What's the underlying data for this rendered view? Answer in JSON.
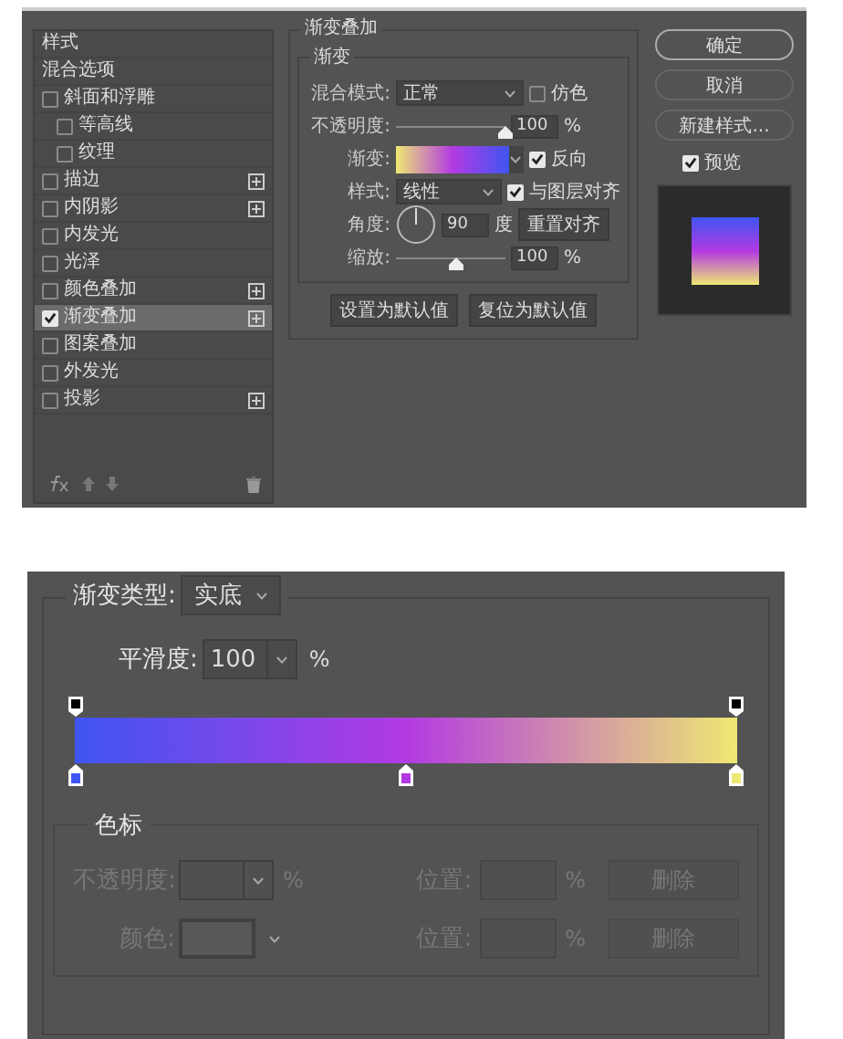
{
  "layer_style": {
    "styles_list": [
      {
        "label": "样式",
        "kind": "header",
        "selected": false
      },
      {
        "label": "混合选项",
        "kind": "header",
        "selected": false
      },
      {
        "label": "斜面和浮雕",
        "kind": "checkbox",
        "checked": false,
        "selected": false,
        "children": [
          {
            "label": "等高线",
            "kind": "checkbox",
            "checked": false,
            "selected": false
          },
          {
            "label": "纹理",
            "kind": "checkbox",
            "checked": false,
            "selected": false
          }
        ]
      },
      {
        "label": "描边",
        "kind": "checkbox",
        "checked": false,
        "selected": false,
        "add_button": true
      },
      {
        "label": "内阴影",
        "kind": "checkbox",
        "checked": false,
        "selected": false,
        "add_button": true
      },
      {
        "label": "内发光",
        "kind": "checkbox",
        "checked": false,
        "selected": false
      },
      {
        "label": "光泽",
        "kind": "checkbox",
        "checked": false,
        "selected": false
      },
      {
        "label": "颜色叠加",
        "kind": "checkbox",
        "checked": false,
        "selected": false,
        "add_button": true
      },
      {
        "label": "渐变叠加",
        "kind": "checkbox",
        "checked": true,
        "selected": true,
        "add_button": true
      },
      {
        "label": "图案叠加",
        "kind": "checkbox",
        "checked": false,
        "selected": false
      },
      {
        "label": "外发光",
        "kind": "checkbox",
        "checked": false,
        "selected": false
      },
      {
        "label": "投影",
        "kind": "checkbox",
        "checked": false,
        "selected": false,
        "add_button": true
      }
    ],
    "section_title": "渐变叠加",
    "group_title": "渐变",
    "blend_mode": {
      "label": "混合模式:",
      "value": "正常"
    },
    "dither": {
      "label": "仿色",
      "checked": false
    },
    "opacity": {
      "label": "不透明度:",
      "level": 1,
      "value": "100",
      "unit": "%"
    },
    "gradient": {
      "label": "渐变:"
    },
    "reverse": {
      "label": "反向",
      "checked": true
    },
    "style": {
      "label": "样式:",
      "value": "线性"
    },
    "align": {
      "label": "与图层对齐",
      "checked": true
    },
    "angle": {
      "label": "角度:",
      "value": "90",
      "unit": "度"
    },
    "reset_align_button": "重置对齐",
    "scale": {
      "label": "缩放:",
      "level": 0.55,
      "value": "100",
      "unit": "%"
    },
    "default_buttons": [
      "设置为默认值",
      "复位为默认值"
    ],
    "actions": [
      {
        "label": "确定",
        "default": true
      },
      {
        "label": "取消",
        "default": false
      },
      {
        "label": "新建样式...",
        "default": false
      }
    ],
    "preview": {
      "label": "预览",
      "checked": true
    }
  },
  "gradient_editor": {
    "gradient_type": {
      "label": "渐变类型:",
      "value": "实底"
    },
    "smoothness": {
      "label": "平滑度:",
      "value": "100",
      "unit": "%"
    },
    "opacity_stops": [
      {
        "color": "#000000"
      },
      {
        "color": "#000000"
      }
    ],
    "color_stops": [
      {
        "color": "#3f55f2"
      },
      {
        "color": "#b33ae2"
      },
      {
        "color": "#eee872"
      }
    ],
    "stops_group": {
      "title": "色标",
      "disabled": true,
      "rows": [
        {
          "kind": "dropdown",
          "label": "不透明度:",
          "unit": "%",
          "position_label": "位置:",
          "position_unit": "%",
          "delete_button": "删除"
        },
        {
          "kind": "swatch",
          "label": "颜色:",
          "position_label": "位置:",
          "position_unit": "%",
          "delete_button": "删除"
        }
      ]
    }
  }
}
